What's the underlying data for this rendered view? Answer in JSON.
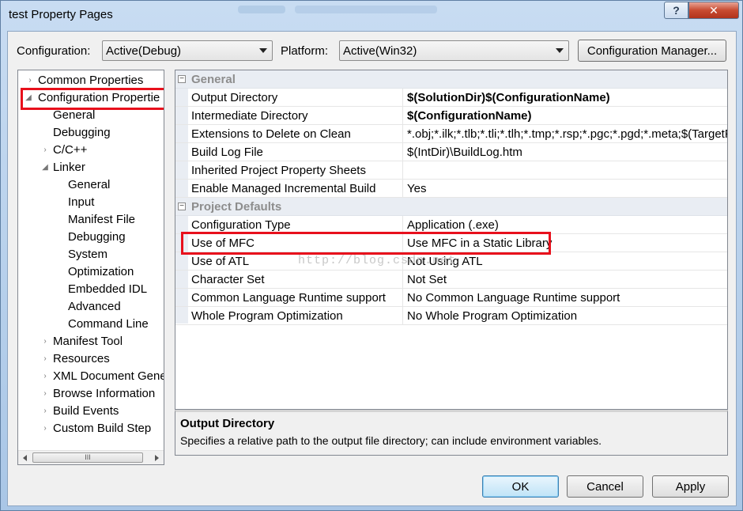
{
  "window": {
    "title": "test Property Pages",
    "help_glyph": "?",
    "close_glyph": "✕"
  },
  "toolbar": {
    "configuration_label": "Configuration:",
    "configuration_value": "Active(Debug)",
    "platform_label": "Platform:",
    "platform_value": "Active(Win32)",
    "config_manager_label": "Configuration Manager..."
  },
  "tree": {
    "items": [
      {
        "label": "Common Properties",
        "tri": "›"
      },
      {
        "label": "Configuration Propertie",
        "tri": "◢"
      },
      {
        "label": "General",
        "tri": ""
      },
      {
        "label": "Debugging",
        "tri": ""
      },
      {
        "label": "C/C++",
        "tri": "›"
      },
      {
        "label": "Linker",
        "tri": "◢"
      },
      {
        "label": "General",
        "tri": ""
      },
      {
        "label": "Input",
        "tri": ""
      },
      {
        "label": "Manifest File",
        "tri": ""
      },
      {
        "label": "Debugging",
        "tri": ""
      },
      {
        "label": "System",
        "tri": ""
      },
      {
        "label": "Optimization",
        "tri": ""
      },
      {
        "label": "Embedded IDL",
        "tri": ""
      },
      {
        "label": "Advanced",
        "tri": ""
      },
      {
        "label": "Command Line",
        "tri": ""
      },
      {
        "label": "Manifest Tool",
        "tri": "›"
      },
      {
        "label": "Resources",
        "tri": "›"
      },
      {
        "label": "XML Document Gene",
        "tri": "›"
      },
      {
        "label": "Browse Information",
        "tri": "›"
      },
      {
        "label": "Build Events",
        "tri": "›"
      },
      {
        "label": "Custom Build Step",
        "tri": "›"
      }
    ],
    "scroll_thumb": "III"
  },
  "grid": {
    "general": {
      "label": "General",
      "toggle": "−",
      "rows": [
        {
          "name": "Output Directory",
          "value": "$(SolutionDir)$(ConfigurationName)"
        },
        {
          "name": "Intermediate Directory",
          "value": "$(ConfigurationName)"
        },
        {
          "name": "Extensions to Delete on Clean",
          "value": "*.obj;*.ilk;*.tlb;*.tli;*.tlh;*.tmp;*.rsp;*.pgc;*.pgd;*.meta;$(TargetPa"
        },
        {
          "name": "Build Log File",
          "value": "$(IntDir)\\BuildLog.htm"
        },
        {
          "name": "Inherited Project Property Sheets",
          "value": ""
        },
        {
          "name": "Enable Managed Incremental Build",
          "value": "Yes"
        }
      ]
    },
    "defaults": {
      "label": "Project Defaults",
      "toggle": "−",
      "rows": [
        {
          "name": "Configuration Type",
          "value": "Application (.exe)"
        },
        {
          "name": "Use of MFC",
          "value": "Use MFC in a Static Library"
        },
        {
          "name": "Use of ATL",
          "value": "Not Using ATL"
        },
        {
          "name": "Character Set",
          "value": "Not Set"
        },
        {
          "name": "Common Language Runtime support",
          "value": "No Common Language Runtime support"
        },
        {
          "name": "Whole Program Optimization",
          "value": "No Whole Program Optimization"
        }
      ]
    },
    "watermark": "http://blog.csdn.net"
  },
  "description": {
    "title": "Output Directory",
    "text": "Specifies a relative path to the output file directory; can include environment variables."
  },
  "buttons": {
    "ok": "OK",
    "cancel": "Cancel",
    "apply": "Apply"
  },
  "colors": {
    "highlight_red": "#e8101c",
    "category_bg": "#e9edf3"
  }
}
